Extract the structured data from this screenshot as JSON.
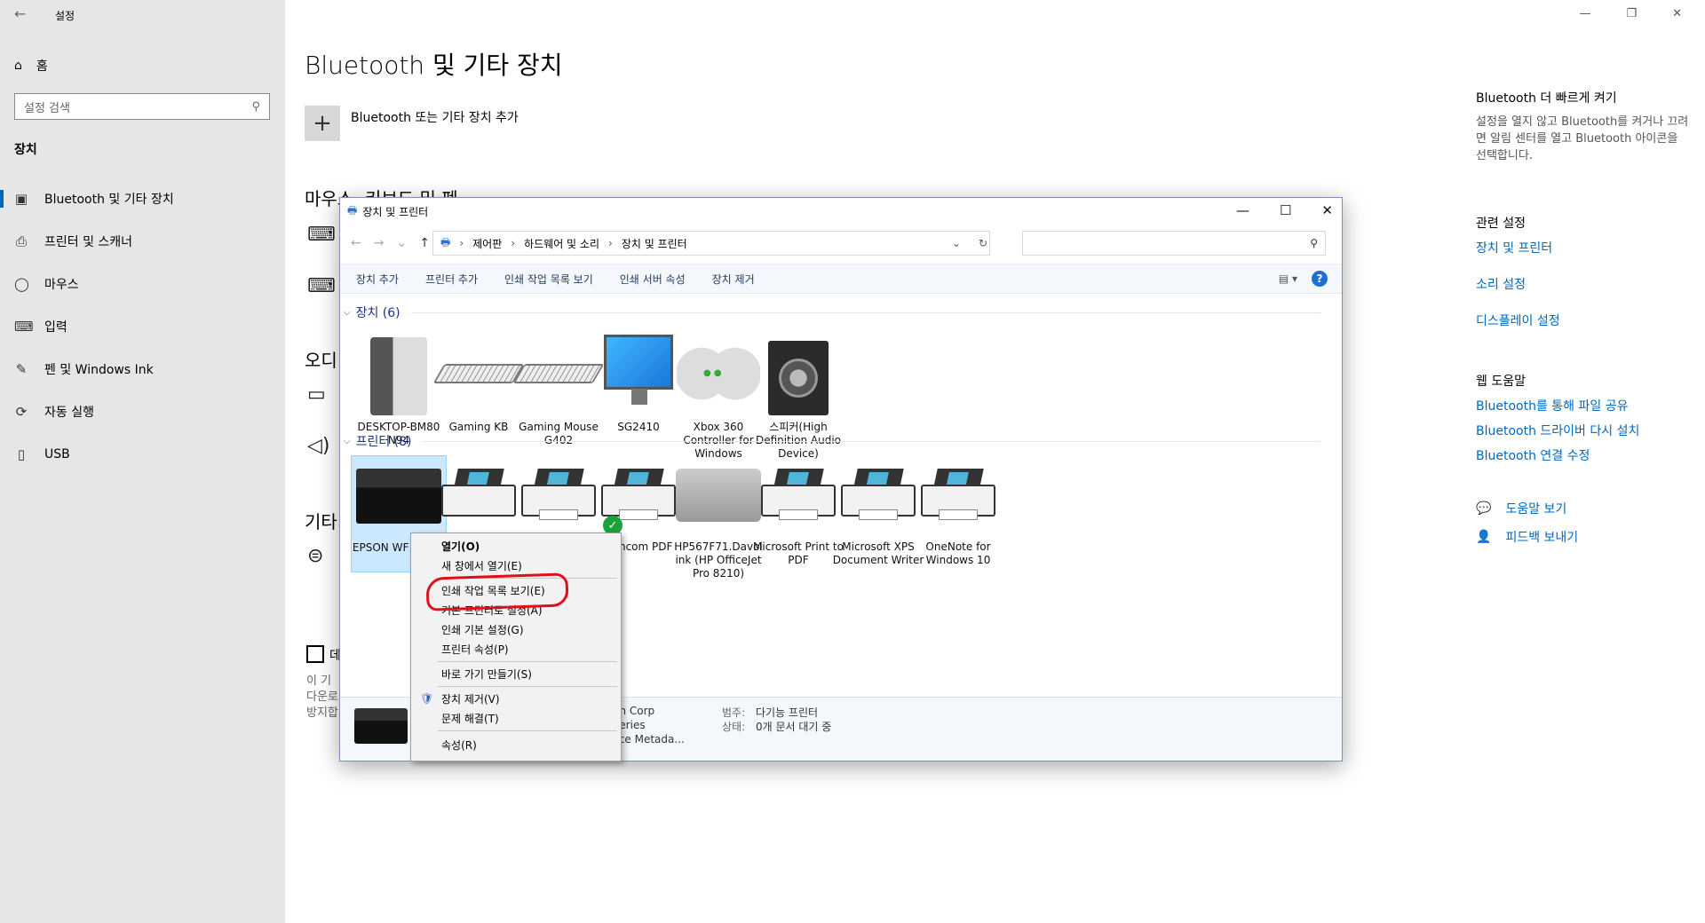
{
  "app": {
    "title": "설정",
    "back_icon": "arrow-left-icon"
  },
  "sidebar": {
    "home": "홈",
    "search_placeholder": "설정 검색",
    "section": "장치",
    "items": [
      {
        "label": "Bluetooth 및 기타 장치",
        "icon": "bluetooth-devices-icon"
      },
      {
        "label": "프린터 및 스캐너",
        "icon": "printer-icon"
      },
      {
        "label": "마우스",
        "icon": "mouse-icon"
      },
      {
        "label": "입력",
        "icon": "keyboard-icon"
      },
      {
        "label": "펜 및 Windows Ink",
        "icon": "pen-icon"
      },
      {
        "label": "자동 실행",
        "icon": "autoplay-icon"
      },
      {
        "label": "USB",
        "icon": "usb-icon"
      }
    ]
  },
  "main": {
    "heading": "Bluetooth 및 기타 장치",
    "add_device": "Bluetooth 또는 기타 장치 추가",
    "mouse_section": "마우스, 키보드 및 펜",
    "audio_section": "오디",
    "other_section": "기타",
    "checkbox_label": "데",
    "desc_lines": [
      "이 기",
      "다운로",
      "방지합"
    ]
  },
  "right_panel": {
    "quick_title": "Bluetooth 더 빠르게 켜기",
    "quick_desc": "설정을 열지 않고 Bluetooth를 켜거나 끄려면 알림 센터를 열고 Bluetooth 아이콘을 선택합니다.",
    "related_title": "관련 설정",
    "related_links": [
      "장치 및 프린터",
      "소리 설정",
      "디스플레이 설정"
    ],
    "web_help_title": "웹 도움말",
    "web_links": [
      "Bluetooth를 통해 파일 공유",
      "Bluetooth 드라이버 다시 설치",
      "Bluetooth 연결 수정"
    ],
    "get_help": "도움말 보기",
    "feedback": "피드백 보내기"
  },
  "dp_window": {
    "title": "장치 및 프린터",
    "breadcrumb": [
      "제어판",
      "하드웨어 및 소리",
      "장치 및 프린터"
    ],
    "commands": [
      "장치 추가",
      "프린터 추가",
      "인쇄 작업 목록 보기",
      "인쇄 서버 속성",
      "장치 제거"
    ],
    "devices_header": "장치 (6)",
    "devices": [
      "DESKTOP-BM80 N94",
      "Gaming KB",
      "Gaming Mouse G402",
      "SG2410",
      "Xbox 360 Controller for Windows",
      "스피커(High Definition Audio Device)"
    ],
    "printers_header": "프린터 (8)",
    "printers": [
      "EPSON WF Series",
      "",
      "o",
      "Hancom PDF",
      "HP567F71.Davol ink (HP OfficeJet Pro 8210)",
      "Microsoft Print to PDF",
      "Microsoft XPS Document Writer",
      "OneNote for Windows 10"
    ],
    "details": {
      "manufacturer_partial": "ko Epson Corp",
      "model_partial": "-2850 Series",
      "desc_partial": "on Device Metada...",
      "category_label": "범주:",
      "category_value": "다기능 프린터",
      "status_label": "상태:",
      "status_value": "0개 문서 대기 중"
    }
  },
  "context_menu": {
    "items": [
      {
        "label": "열기(O)",
        "bold": true
      },
      {
        "label": "새 창에서 열기(E)"
      },
      {
        "label": "인쇄 작업 목록 보기(E)"
      },
      {
        "label": "기본 프린터로 설정(A)"
      },
      {
        "label": "인쇄 기본 설정(G)"
      },
      {
        "label": "프린터 속성(P)"
      },
      {
        "label": "바로 가기 만들기(S)"
      },
      {
        "label": "장치 제거(V)"
      },
      {
        "label": "문제 해결(T)"
      },
      {
        "label": "속성(R)"
      }
    ]
  },
  "colors": {
    "accent": "#0067c0",
    "annotation": "#e0101a",
    "selection": "#cce8ff"
  }
}
